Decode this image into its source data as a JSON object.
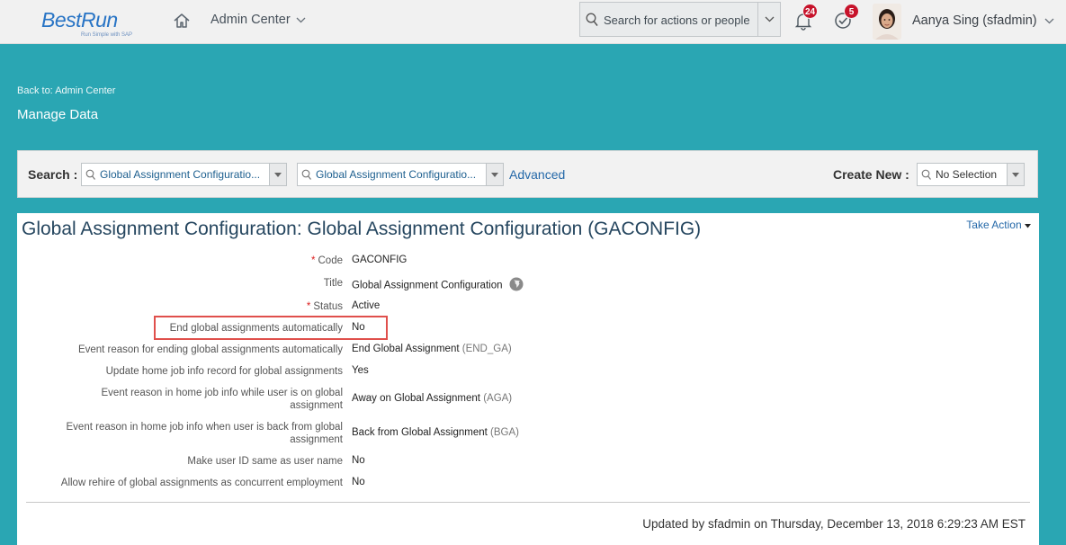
{
  "shell": {
    "logo_text": "BestRun",
    "logo_tagline": "Run Simple with SAP",
    "nav_title": "Admin Center",
    "search_placeholder": "Search for actions or people",
    "notifications_count": "24",
    "todo_count": "5",
    "user_name": "Aanya Sing (sfadmin)"
  },
  "page": {
    "back_link": "Back to: Admin Center",
    "title": "Manage Data"
  },
  "search_panel": {
    "search_label": "Search :",
    "search_type_value": "Global Assignment Configuratio...",
    "search_object_value": "Global Assignment Configuratio...",
    "advanced_link": "Advanced",
    "create_new_label": "Create New :",
    "create_new_value": "No Selection"
  },
  "record": {
    "title": "Global Assignment Configuration: Global Assignment Configuration (GACONFIG)",
    "take_action": "Take Action",
    "fields": [
      {
        "label": "Code",
        "required": "*",
        "value": "GACONFIG",
        "code": ""
      },
      {
        "label": "Title",
        "required": "",
        "value": "Global Assignment Configuration",
        "code": ""
      },
      {
        "label": "Status",
        "required": "*",
        "value": "Active",
        "code": ""
      },
      {
        "label": "End global assignments automatically",
        "required": "",
        "value": "No",
        "code": ""
      },
      {
        "label": "Event reason for ending global assignments automatically",
        "required": "",
        "value": "End Global Assignment",
        "code": "(END_GA)"
      },
      {
        "label": "Update home job info record for global assignments",
        "required": "",
        "value": "Yes",
        "code": ""
      },
      {
        "label": "Event reason in home job info while user is on global assignment",
        "required": "",
        "value": "Away on Global Assignment",
        "code": "(AGA)"
      },
      {
        "label": "Event reason in home job info when user is back from global assignment",
        "required": "",
        "value": "Back from Global Assignment",
        "code": "(BGA)"
      },
      {
        "label": "Make user ID same as user name",
        "required": "",
        "value": "No",
        "code": ""
      },
      {
        "label": "Allow rehire of global assignments as concurrent employment",
        "required": "",
        "value": "No",
        "code": ""
      }
    ],
    "updated": "Updated by sfadmin on Thursday, December 13, 2018 6:29:23 AM EST"
  },
  "colors": {
    "background": "#2aa6b3",
    "link": "#2468a8",
    "badge": "#c7132b",
    "highlight_box": "#e0504c"
  }
}
